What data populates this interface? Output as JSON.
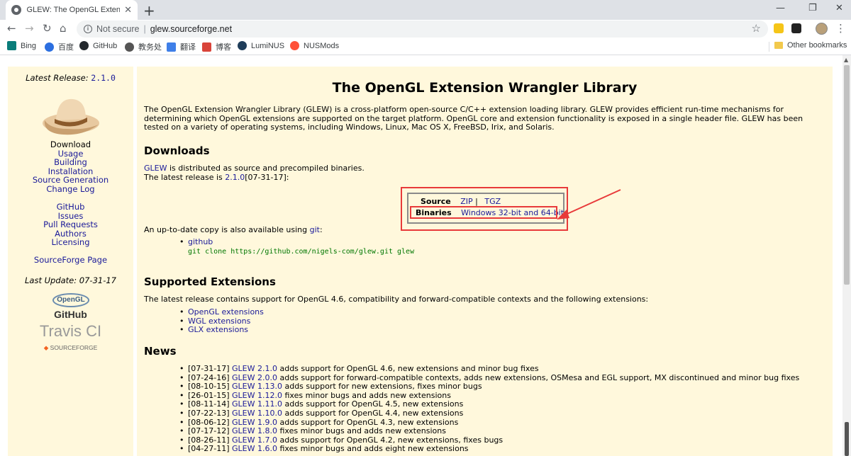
{
  "browser": {
    "tab_title": "GLEW: The OpenGL Extension",
    "new_tab": "+",
    "not_secure": "Not secure",
    "separator": "|",
    "url": "glew.sourceforge.net",
    "bookmarks": [
      "Bing",
      "百度",
      "GitHub",
      "教务处",
      "翻译",
      "博客",
      "LumiNUS",
      "NUSMods"
    ],
    "other_bookmarks": "Other bookmarks"
  },
  "sidebar": {
    "latest_release_label": "Latest Release:",
    "latest_release_version": "2.1.0",
    "download": "Download",
    "nav1": [
      "Usage",
      "Building",
      "Installation",
      "Source Generation",
      "Change Log"
    ],
    "nav2": [
      "GitHub",
      "Issues",
      "Pull Requests",
      "Authors",
      "Licensing"
    ],
    "sourceforge_page": "SourceForge Page",
    "last_update": "Last Update: 07-31-17",
    "logos": {
      "opengl": "OpenGL",
      "github": "GitHub",
      "travis": "Travis CI",
      "sourceforge": "SOURCEFORGE"
    }
  },
  "main": {
    "title": "The OpenGL Extension Wrangler Library",
    "intro": "The OpenGL Extension Wrangler Library (GLEW) is a cross-platform open-source C/C++ extension loading library. GLEW provides efficient run-time mechanisms for determining which OpenGL extensions are supported on the target platform. OpenGL core and extension functionality is exposed in a single header file. GLEW has been tested on a variety of operating systems, including Windows, Linux, Mac OS X, FreeBSD, Irix, and Solaris.",
    "downloads_heading": "Downloads",
    "glew_link": "GLEW",
    "distributed_text": " is distributed as source and precompiled binaries.",
    "latest_release_prefix": "The latest release is ",
    "latest_release_link": "2.1.0",
    "latest_release_suffix": "[07-31-17]:",
    "source_label": "Source",
    "zip": "ZIP",
    "pipe": "|",
    "tgz": "TGZ",
    "binaries_label": "Binaries",
    "binaries_link": "Windows 32-bit and 64-bit",
    "git_copy_prefix": "An up-to-date copy is also available using ",
    "git_link": "git",
    "git_copy_suffix": ":",
    "github_link": "github",
    "git_clone": "git clone https://github.com/nigels-com/glew.git glew",
    "supported_heading": "Supported Extensions",
    "supported_text": "The latest release contains support for OpenGL 4.6, compatibility and forward-compatible contexts and the following extensions:",
    "ext_links": [
      "OpenGL extensions",
      "WGL extensions",
      "GLX extensions"
    ],
    "news_heading": "News",
    "news": [
      {
        "date": "[07-31-17]",
        "link": "GLEW 2.1.0",
        "text": " adds support for OpenGL 4.6, new extensions and minor bug fixes"
      },
      {
        "date": "[07-24-16]",
        "link": "GLEW 2.0.0",
        "text": " adds support for forward-compatible contexts, adds new extensions, OSMesa and EGL support, MX discontinued and minor bug fixes"
      },
      {
        "date": "[08-10-15]",
        "link": "GLEW 1.13.0",
        "text": " adds support for new extensions, fixes minor bugs"
      },
      {
        "date": "[26-01-15]",
        "link": "GLEW 1.12.0",
        "text": " fixes minor bugs and adds new extensions"
      },
      {
        "date": "[08-11-14]",
        "link": "GLEW 1.11.0",
        "text": " adds support for OpenGL 4.5, new extensions"
      },
      {
        "date": "[07-22-13]",
        "link": "GLEW 1.10.0",
        "text": " adds support for OpenGL 4.4, new extensions"
      },
      {
        "date": "[08-06-12]",
        "link": "GLEW 1.9.0",
        "text": " adds support for OpenGL 4.3, new extensions"
      },
      {
        "date": "[07-17-12]",
        "link": "GLEW 1.8.0",
        "text": " fixes minor bugs and adds new extensions"
      },
      {
        "date": "[08-26-11]",
        "link": "GLEW 1.7.0",
        "text": " adds support for OpenGL 4.2, new extensions, fixes bugs"
      },
      {
        "date": "[04-27-11]",
        "link": "GLEW 1.6.0",
        "text": " fixes minor bugs and adds eight new extensions"
      }
    ]
  },
  "colors": {
    "page_bg": "#fff8dc",
    "link": "#1a1a99",
    "highlight": "#e83a3a",
    "code": "#007700"
  }
}
